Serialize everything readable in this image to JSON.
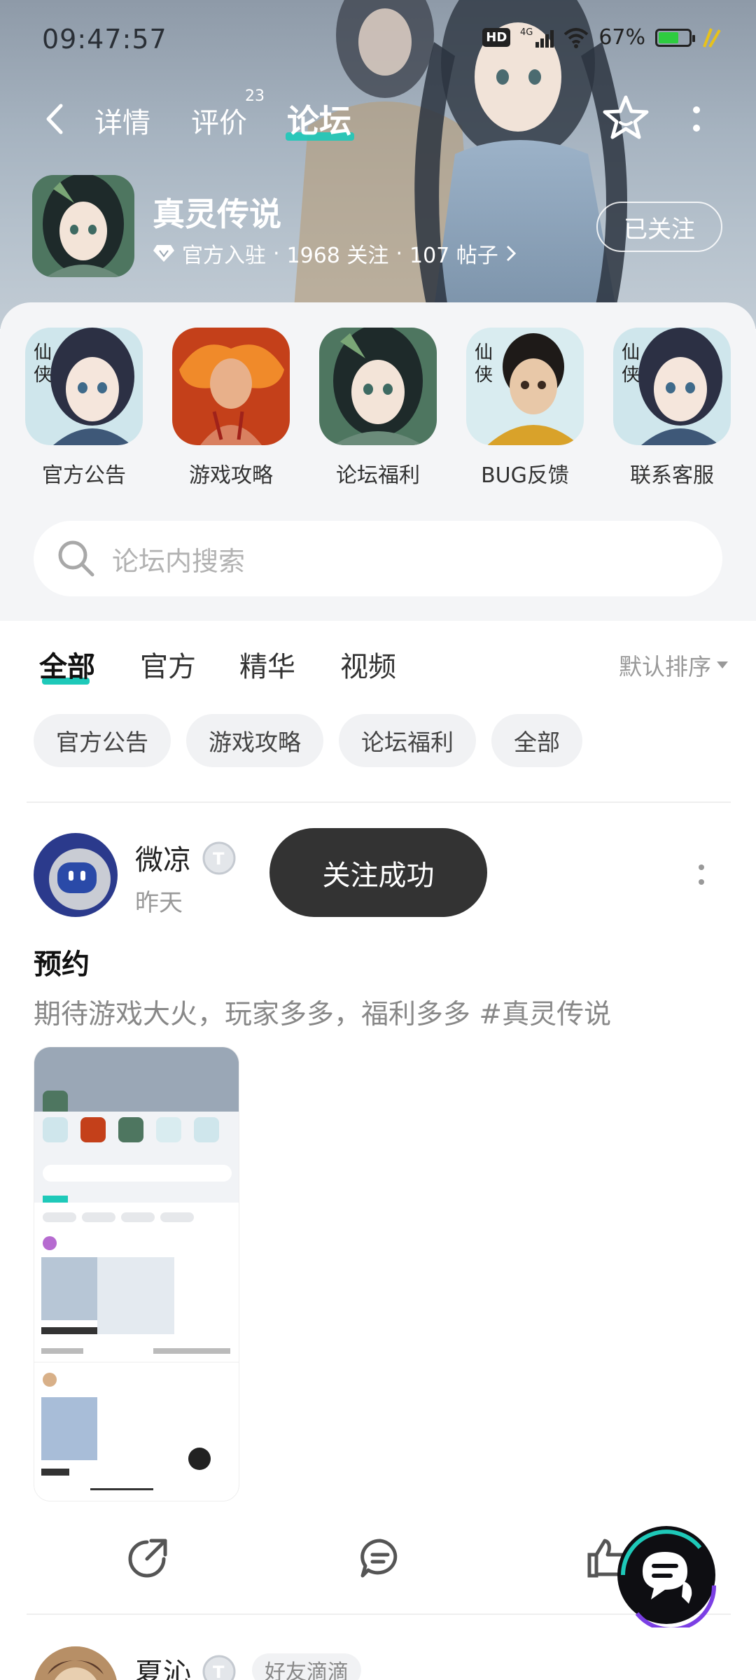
{
  "status_bar": {
    "time": "09:47:57",
    "hd": "HD",
    "network": "4G",
    "battery": "67%",
    "battery_level": 0.67
  },
  "nav": {
    "tabs": [
      {
        "label": "详情"
      },
      {
        "label": "评价",
        "badge": "23"
      },
      {
        "label": "论坛"
      }
    ],
    "active_tab": "论坛"
  },
  "game": {
    "title": "真灵传说",
    "meta_official": "官方入驻",
    "meta_sep": "·",
    "meta_followers": "1968 关注",
    "meta_posts": "107 帖子",
    "follow_label": "已关注"
  },
  "categories": [
    {
      "label": "官方公告"
    },
    {
      "label": "游戏攻略"
    },
    {
      "label": "论坛福利"
    },
    {
      "label": "BUG反馈"
    },
    {
      "label": "联系客服"
    }
  ],
  "search": {
    "placeholder": "论坛内搜索"
  },
  "filters": {
    "tabs": [
      "全部",
      "官方",
      "精华",
      "视频"
    ],
    "sort": "默认排序",
    "chips": [
      "官方公告",
      "游戏攻略",
      "论坛福利",
      "全部"
    ]
  },
  "post": {
    "user": "微凉",
    "time": "昨天",
    "title": "预约",
    "body": "期待游戏大火，玩家多多，福利多多 #真灵传说"
  },
  "toast": "关注成功",
  "next_post": {
    "user": "夏沁",
    "tag": "好友滴滴"
  },
  "colors": {
    "accent": "#1ec9b9",
    "toast_bg": "#333333",
    "battery": "#2ecc40"
  }
}
